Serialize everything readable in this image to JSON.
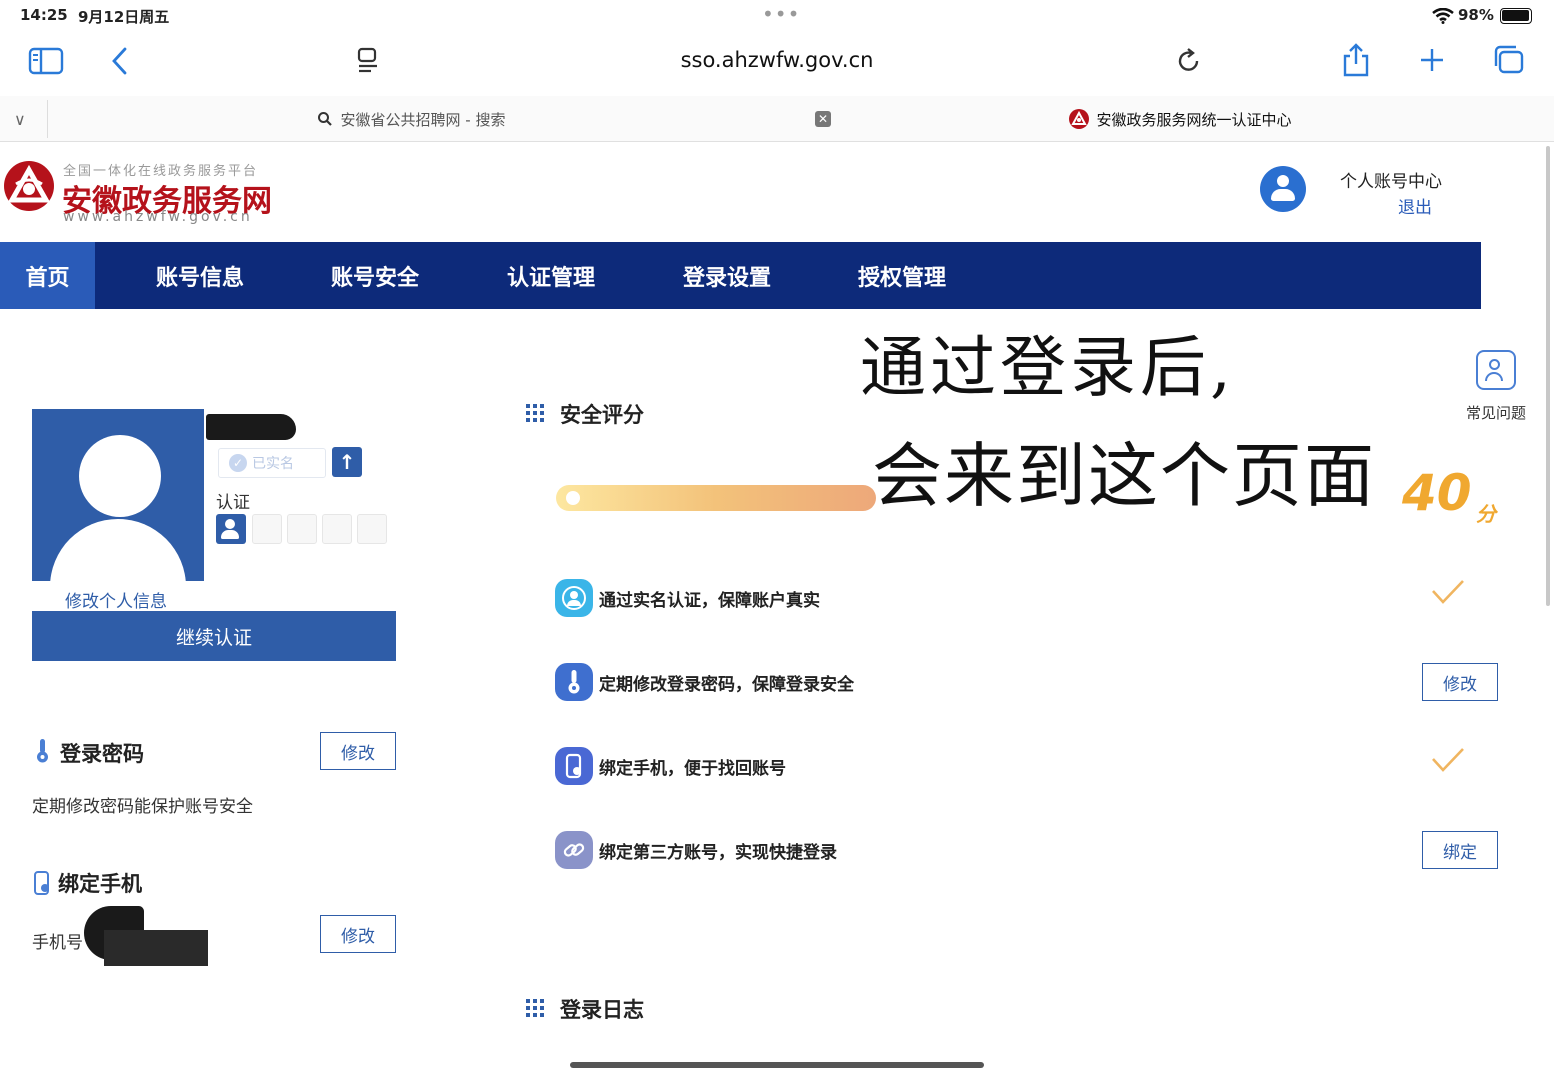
{
  "status_bar": {
    "time": "14:25",
    "date": "9月12日周五",
    "battery_pct": "98%"
  },
  "browser": {
    "url": "sso.ahzwfw.gov.cn",
    "tab_overflow": "∨"
  },
  "tabs": [
    {
      "label": "安徽省公共招聘网 - 搜索"
    },
    {
      "label": "安徽政务服务网统一认证中心"
    }
  ],
  "site": {
    "logo_tagline": "全国一体化在线政务服务平台",
    "logo_title": "安徽政务服务网",
    "logo_url": "www.ahzwfw.gov.cn",
    "account_center": "个人账号中心",
    "logout": "退出"
  },
  "nav": {
    "items": [
      "首页",
      "账号信息",
      "账号安全",
      "认证管理",
      "登录设置",
      "授权管理"
    ],
    "active_index": 0
  },
  "profile": {
    "verified_badge": "已实名",
    "auth_label": "认证",
    "edit_profile": "修改个人信息",
    "continue_auth": "继续认证"
  },
  "login_password": {
    "title": "登录密码",
    "desc": "定期修改密码能保护账号安全",
    "button": "修改"
  },
  "bind_phone": {
    "title": "绑定手机",
    "label": "手机号",
    "button": "修改"
  },
  "security": {
    "title": "安全评分",
    "score": "40",
    "score_unit": "分",
    "score_fraction": 0.55,
    "items": [
      {
        "text": "通过实名认证，保障账户真实",
        "action": "done"
      },
      {
        "text": "定期修改登录密码，保障登录安全",
        "action": "修改"
      },
      {
        "text": "绑定手机，便于找回账号",
        "action": "done"
      },
      {
        "text": "绑定第三方账号，实现快捷登录",
        "action": "绑定"
      }
    ]
  },
  "login_log": {
    "title": "登录日志"
  },
  "faq": {
    "label": "常见问题"
  },
  "handwriting": {
    "line1": "通过登录后,",
    "line2": "会来到这个页面"
  },
  "colors": {
    "nav_bg": "#0d2a7a",
    "nav_active": "#2a5bb8",
    "brand_red": "#b5121b",
    "accent_blue": "#2f5da8",
    "score_orange": "#f0a830"
  }
}
